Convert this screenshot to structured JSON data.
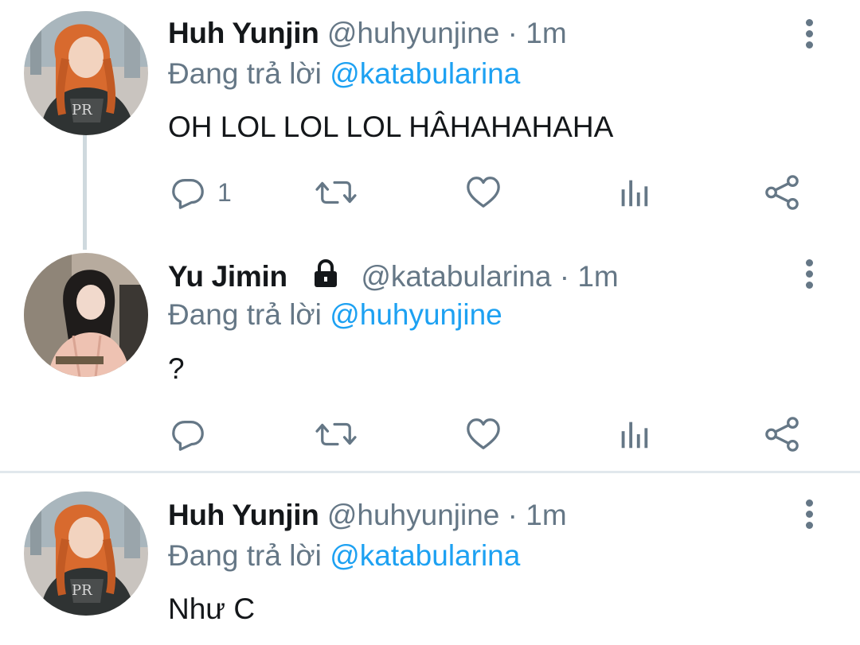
{
  "tweets": [
    {
      "display_name": "Huh Yunjin",
      "handle": "@huhyunjine · 1m",
      "replying_prefix": "Đang trả lời ",
      "replying_to": "@katabularina",
      "text": "OH LOL LOL LOL HÂHAHAHAHA",
      "reply_count": "1"
    },
    {
      "display_name": "Yu Jimin",
      "handle": "@katabularina · 1m",
      "replying_prefix": "Đang trả lời ",
      "replying_to": "@huhyunjine",
      "text": "?",
      "reply_count": ""
    },
    {
      "display_name": "Huh Yunjin",
      "handle": "@huhyunjine · 1m",
      "replying_prefix": "Đang trả lời ",
      "replying_to": "@katabularina",
      "text": "Như C",
      "reply_count": ""
    }
  ],
  "icons": {
    "reply": "reply-icon",
    "retweet": "retweet-icon",
    "like": "heart-icon",
    "analytics": "analytics-icon",
    "share": "share-icon",
    "more": "more-vertical-icon",
    "protected": "lock-icon"
  },
  "colors": {
    "accent": "#1da1f2",
    "secondary_text": "#657786",
    "primary_text": "#14171a",
    "divider": "#e1e8ed",
    "thread_line": "#cfd9de"
  }
}
